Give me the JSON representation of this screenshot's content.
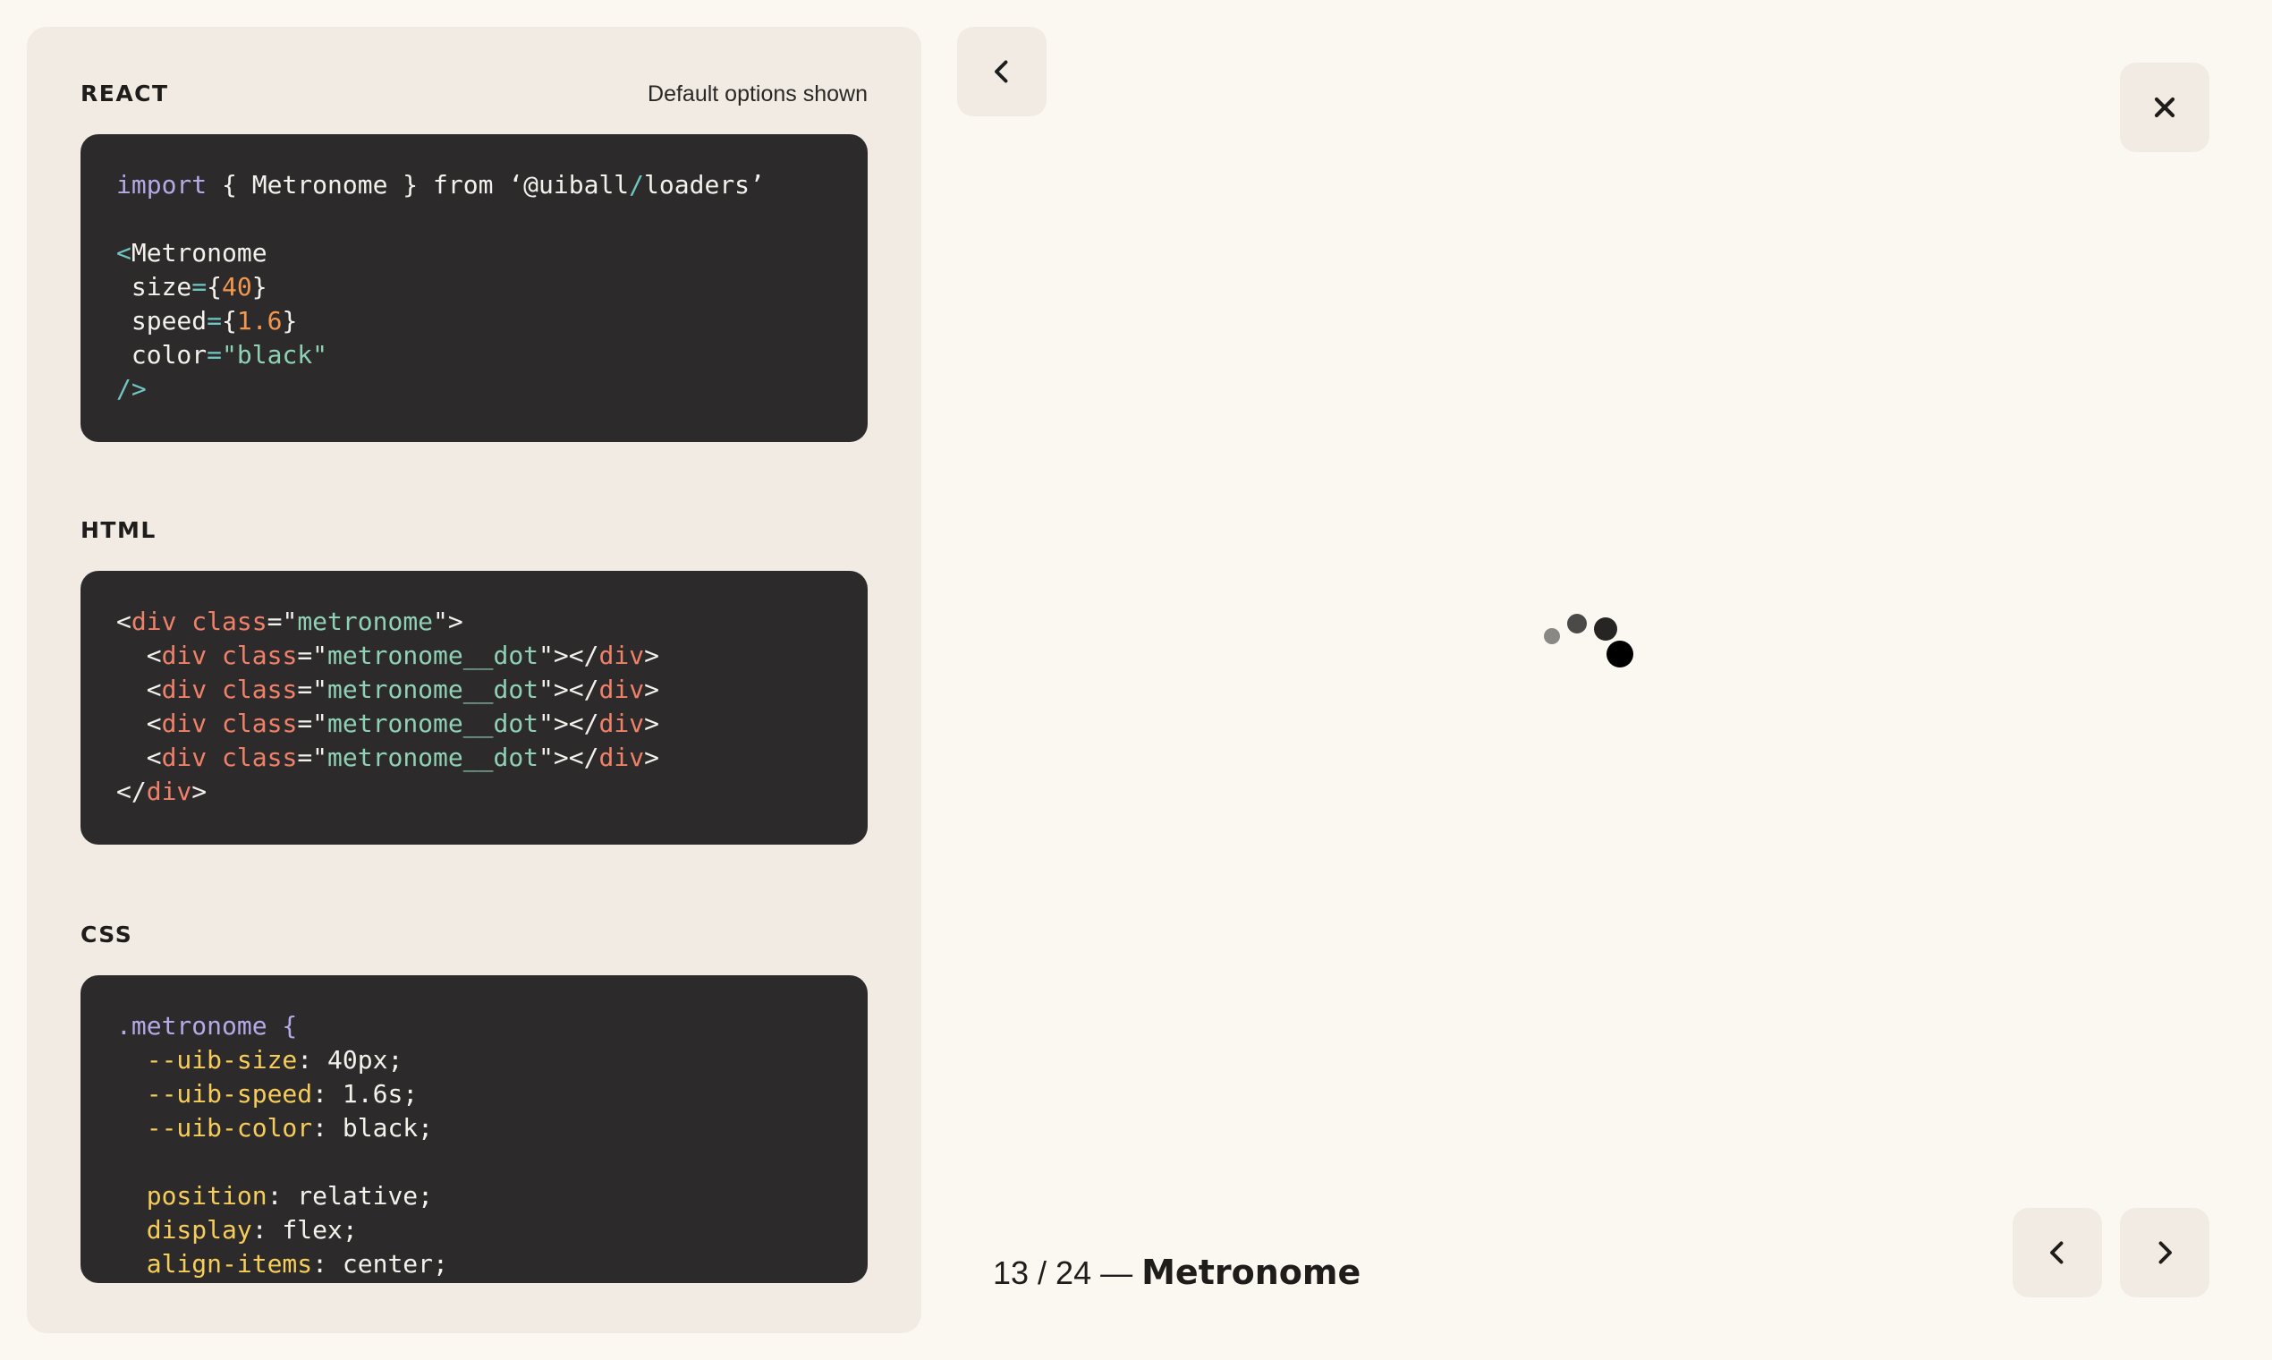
{
  "sections": {
    "react": {
      "title": "REACT",
      "note": "Default options shown",
      "code": [
        [
          {
            "t": "import",
            "c": "kw"
          },
          {
            "t": " { Metronome } from ‘@uiball"
          },
          {
            "t": "/",
            "c": "cyan"
          },
          {
            "t": "loaders’"
          }
        ],
        [],
        [
          {
            "t": "<",
            "c": "cyan"
          },
          {
            "t": "Metronome"
          }
        ],
        [
          {
            "t": " size"
          },
          {
            "t": "=",
            "c": "cyan"
          },
          {
            "t": "{"
          },
          {
            "t": "40",
            "c": "num"
          },
          {
            "t": "}"
          }
        ],
        [
          {
            "t": " speed"
          },
          {
            "t": "=",
            "c": "cyan"
          },
          {
            "t": "{"
          },
          {
            "t": "1.6",
            "c": "num"
          },
          {
            "t": "}"
          }
        ],
        [
          {
            "t": " color"
          },
          {
            "t": "=",
            "c": "cyan"
          },
          {
            "t": "\"black\"",
            "c": "str"
          }
        ],
        [
          {
            "t": "/>",
            "c": "cyan"
          }
        ]
      ]
    },
    "html": {
      "title": "HTML",
      "code": [
        [
          {
            "t": "<"
          },
          {
            "t": "div",
            "c": "tag"
          },
          {
            "t": " class",
            "c": "tag"
          },
          {
            "t": "=\""
          },
          {
            "t": "metronome",
            "c": "str"
          },
          {
            "t": "\">"
          }
        ],
        [
          {
            "t": "  <"
          },
          {
            "t": "div",
            "c": "tag"
          },
          {
            "t": " class",
            "c": "tag"
          },
          {
            "t": "=\""
          },
          {
            "t": "metronome__dot",
            "c": "str"
          },
          {
            "t": "\"></"
          },
          {
            "t": "div",
            "c": "tag"
          },
          {
            "t": ">"
          }
        ],
        [
          {
            "t": "  <"
          },
          {
            "t": "div",
            "c": "tag"
          },
          {
            "t": " class",
            "c": "tag"
          },
          {
            "t": "=\""
          },
          {
            "t": "metronome__dot",
            "c": "str"
          },
          {
            "t": "\"></"
          },
          {
            "t": "div",
            "c": "tag"
          },
          {
            "t": ">"
          }
        ],
        [
          {
            "t": "  <"
          },
          {
            "t": "div",
            "c": "tag"
          },
          {
            "t": " class",
            "c": "tag"
          },
          {
            "t": "=\""
          },
          {
            "t": "metronome__dot",
            "c": "str"
          },
          {
            "t": "\"></"
          },
          {
            "t": "div",
            "c": "tag"
          },
          {
            "t": ">"
          }
        ],
        [
          {
            "t": "  <"
          },
          {
            "t": "div",
            "c": "tag"
          },
          {
            "t": " class",
            "c": "tag"
          },
          {
            "t": "=\""
          },
          {
            "t": "metronome__dot",
            "c": "str"
          },
          {
            "t": "\"></"
          },
          {
            "t": "div",
            "c": "tag"
          },
          {
            "t": ">"
          }
        ],
        [
          {
            "t": "</"
          },
          {
            "t": "div",
            "c": "tag"
          },
          {
            "t": ">"
          }
        ]
      ]
    },
    "css": {
      "title": "CSS",
      "code": [
        [
          {
            "t": ".metronome {",
            "c": "kw"
          }
        ],
        [
          {
            "t": "  --uib-size",
            "c": "prop"
          },
          {
            "t": ": 40px;"
          }
        ],
        [
          {
            "t": "  --uib-speed",
            "c": "prop"
          },
          {
            "t": ": 1.6s;"
          }
        ],
        [
          {
            "t": "  --uib-color",
            "c": "prop"
          },
          {
            "t": ": black;"
          }
        ],
        [],
        [
          {
            "t": "  position",
            "c": "prop"
          },
          {
            "t": ": relative;"
          }
        ],
        [
          {
            "t": "  display",
            "c": "prop"
          },
          {
            "t": ": flex;"
          }
        ],
        [
          {
            "t": "  align-items",
            "c": "prop"
          },
          {
            "t": ": center;"
          }
        ]
      ]
    }
  },
  "icons": {
    "back": "chevron-left-icon",
    "close": "close-icon",
    "prev": "chevron-left-icon",
    "next": "chevron-right-icon"
  },
  "colors": {
    "page_bg": "#fbf8f2",
    "panel_bg": "#f1ebe4",
    "code_bg": "#2d2a2b",
    "keyword": "#b6a9e6",
    "string": "#8fd1b5",
    "number": "#f2974f",
    "tag": "#ef8169",
    "property": "#f7cd5a"
  },
  "caption": {
    "counter": "13 / 24 —",
    "name": "Metronome"
  }
}
